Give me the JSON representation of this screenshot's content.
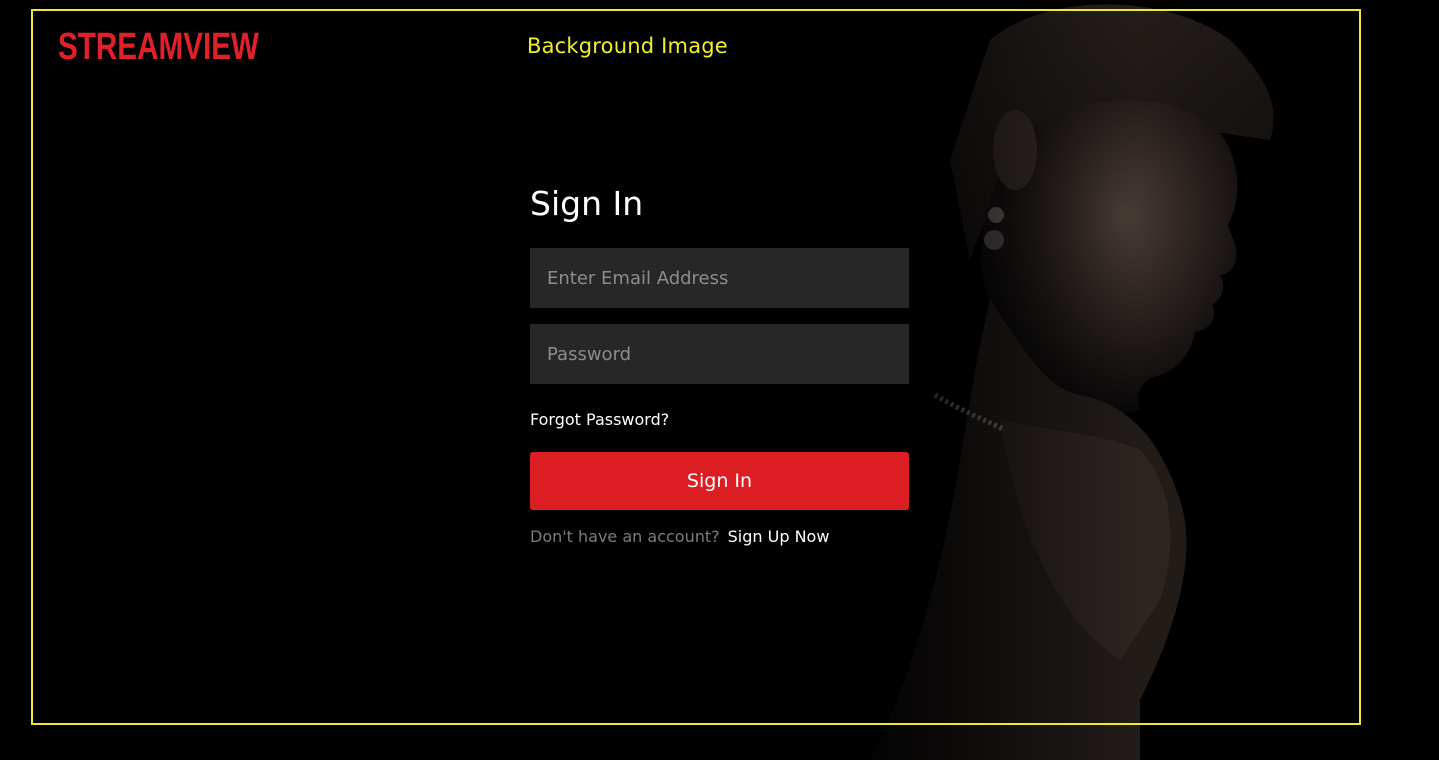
{
  "brand": {
    "logo_text": "STREAMVIEW",
    "logo_color": "#e0212a"
  },
  "annotation": {
    "frame_label": "Background Image",
    "frame_color": "#f1ea2b"
  },
  "form": {
    "title": "Sign In",
    "email_placeholder": "Enter Email Address",
    "password_placeholder": "Password",
    "forgot_label": "Forgot Password?",
    "submit_label": "Sign In",
    "signup_prompt": "Don't have an account?",
    "signup_link": "Sign Up Now"
  },
  "colors": {
    "button": "#dc1e24",
    "field_bg": "#272727",
    "page_bg": "#000000"
  }
}
